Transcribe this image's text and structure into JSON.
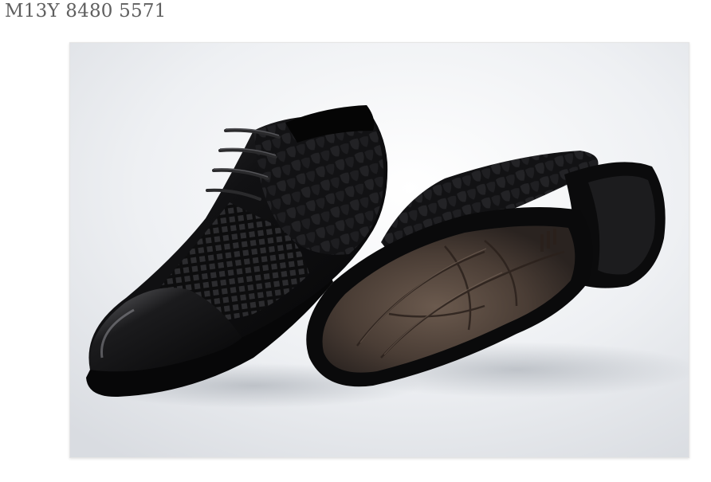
{
  "product": {
    "code": "M13Y 8480 5571"
  },
  "image": {
    "subject_icon": "shoe-pair-icon",
    "background_color": "#eff1f4"
  }
}
